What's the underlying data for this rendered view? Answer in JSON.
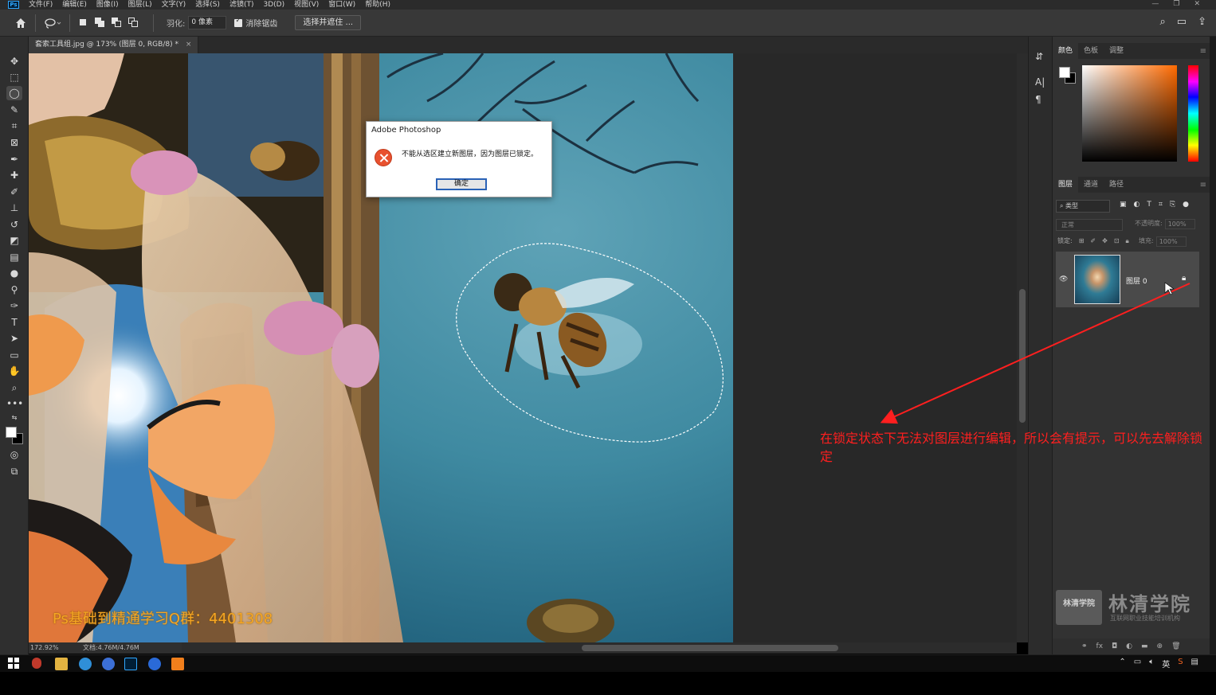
{
  "menubar": {
    "logo": "Ps",
    "items": [
      "文件(F)",
      "编辑(E)",
      "图像(I)",
      "图层(L)",
      "文字(Y)",
      "选择(S)",
      "滤镜(T)",
      "3D(D)",
      "视图(V)",
      "窗口(W)",
      "帮助(H)"
    ]
  },
  "options": {
    "feather_label": "羽化:",
    "feather_value": "0 像素",
    "antialias_label": "消除锯齿",
    "select_mask_label": "选择并遮住 ..."
  },
  "document": {
    "tab_title": "套索工具组.jpg @ 173% (图层 0, RGB/8) *",
    "close": "×",
    "zoom": "172.92%",
    "doc_size": "文档:4.76M/4.76M"
  },
  "canvas": {
    "watermark": "Ps基础到精通学习Q群：4401308"
  },
  "dialog": {
    "title": "Adobe Photoshop",
    "message": "不能从选区建立新图层，因为图层已锁定。",
    "ok_label": "确定"
  },
  "color_panel": {
    "tabs": [
      "颜色",
      "色板",
      "调整"
    ]
  },
  "layers_panel": {
    "tabs": [
      "图层",
      "通道",
      "路径"
    ],
    "filter_label": "类型",
    "blend_mode": "正常",
    "opacity_label": "不透明度:",
    "opacity_value": "100%",
    "lock_label": "锁定:",
    "fill_label": "填充:",
    "fill_value": "100%",
    "layer_name": "图层 0"
  },
  "brand": {
    "badge": "林清学院",
    "name": "林清学院",
    "tagline": "互联网职业技能培训机构"
  },
  "annotation": {
    "text": "在锁定状态下无法对图层进行编辑，所以会有提示，可以先去解除锁定",
    "color": "#ff1f1f"
  },
  "taskbar": {
    "tray_lang": "英"
  }
}
